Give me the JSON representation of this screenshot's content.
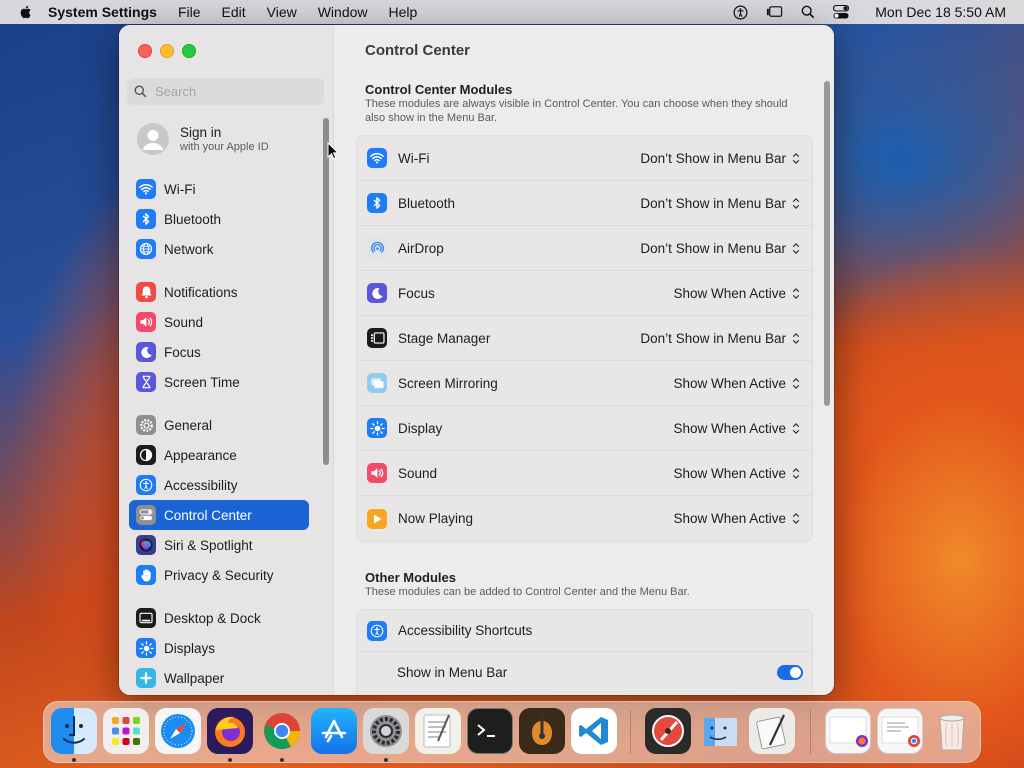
{
  "menubar": {
    "app_name": "System Settings",
    "menus": [
      "File",
      "Edit",
      "View",
      "Window",
      "Help"
    ],
    "clock": "Mon Dec 18  5:50 AM"
  },
  "sidebar": {
    "search_placeholder": "Search",
    "account_title": "Sign in",
    "account_subtitle": "with your Apple ID",
    "items": [
      {
        "label": "Wi-Fi",
        "icon": "wifi-icon",
        "color": "#1e7cf5"
      },
      {
        "label": "Bluetooth",
        "icon": "bluetooth-icon",
        "color": "#1e7cf5"
      },
      {
        "label": "Network",
        "icon": "globe-icon",
        "color": "#1e7cf5"
      },
      {
        "label": "Notifications",
        "icon": "bell-icon",
        "color": "#f04b45"
      },
      {
        "label": "Sound",
        "icon": "speaker-icon",
        "color": "#f04b6b"
      },
      {
        "label": "Focus",
        "icon": "moon-icon",
        "color": "#5b57d9"
      },
      {
        "label": "Screen Time",
        "icon": "hourglass-icon",
        "color": "#5b57d9"
      },
      {
        "label": "General",
        "icon": "gear-icon",
        "color": "#8e8e93"
      },
      {
        "label": "Appearance",
        "icon": "appearance-icon",
        "color": "#1c1c1e"
      },
      {
        "label": "Accessibility",
        "icon": "accessibility-icon",
        "color": "#1e7cf5"
      },
      {
        "label": "Control Center",
        "icon": "control-center-icon",
        "color": "#8e8e93"
      },
      {
        "label": "Siri & Spotlight",
        "icon": "siri-icon",
        "color": "#3b3b8f"
      },
      {
        "label": "Privacy & Security",
        "icon": "hand-icon",
        "color": "#1e7cf5"
      },
      {
        "label": "Desktop & Dock",
        "icon": "dock-icon",
        "color": "#1c1c1e"
      },
      {
        "label": "Displays",
        "icon": "sun-icon",
        "color": "#1e7cf5"
      },
      {
        "label": "Wallpaper",
        "icon": "wallpaper-icon",
        "color": "#37b5e8"
      }
    ],
    "selected": "Control Center"
  },
  "main": {
    "title": "Control Center",
    "modules_title": "Control Center Modules",
    "modules_desc": "These modules are always visible in Control Center. You can choose when they should also show in the Menu Bar.",
    "modules": [
      {
        "label": "Wi-Fi",
        "value": "Don’t Show in Menu Bar",
        "icon": "wifi-icon",
        "color": "#1e7cf5"
      },
      {
        "label": "Bluetooth",
        "value": "Don’t Show in Menu Bar",
        "icon": "bluetooth-icon",
        "color": "#1e7cf5"
      },
      {
        "label": "AirDrop",
        "value": "Don’t Show in Menu Bar",
        "icon": "airdrop-icon",
        "color": "#dfe3ea"
      },
      {
        "label": "Focus",
        "value": "Show When Active",
        "icon": "moon-icon",
        "color": "#5b57d9"
      },
      {
        "label": "Stage Manager",
        "value": "Don’t Show in Menu Bar",
        "icon": "stage-manager-icon",
        "color": "#1c1c1e"
      },
      {
        "label": "Screen Mirroring",
        "value": "Show When Active",
        "icon": "screen-mirroring-icon",
        "color": "#8ecdf0"
      },
      {
        "label": "Display",
        "value": "Show When Active",
        "icon": "sun-icon",
        "color": "#1e7cf5"
      },
      {
        "label": "Sound",
        "value": "Show When Active",
        "icon": "speaker-icon",
        "color": "#f04b6b"
      },
      {
        "label": "Now Playing",
        "value": "Show When Active",
        "icon": "play-icon",
        "color": "#f7a421"
      }
    ],
    "other_title": "Other Modules",
    "other_desc": "These modules can be added to Control Center and the Menu Bar.",
    "other": {
      "label": "Accessibility Shortcuts",
      "sub_label": "Show in Menu Bar",
      "toggle_on": true
    }
  }
}
